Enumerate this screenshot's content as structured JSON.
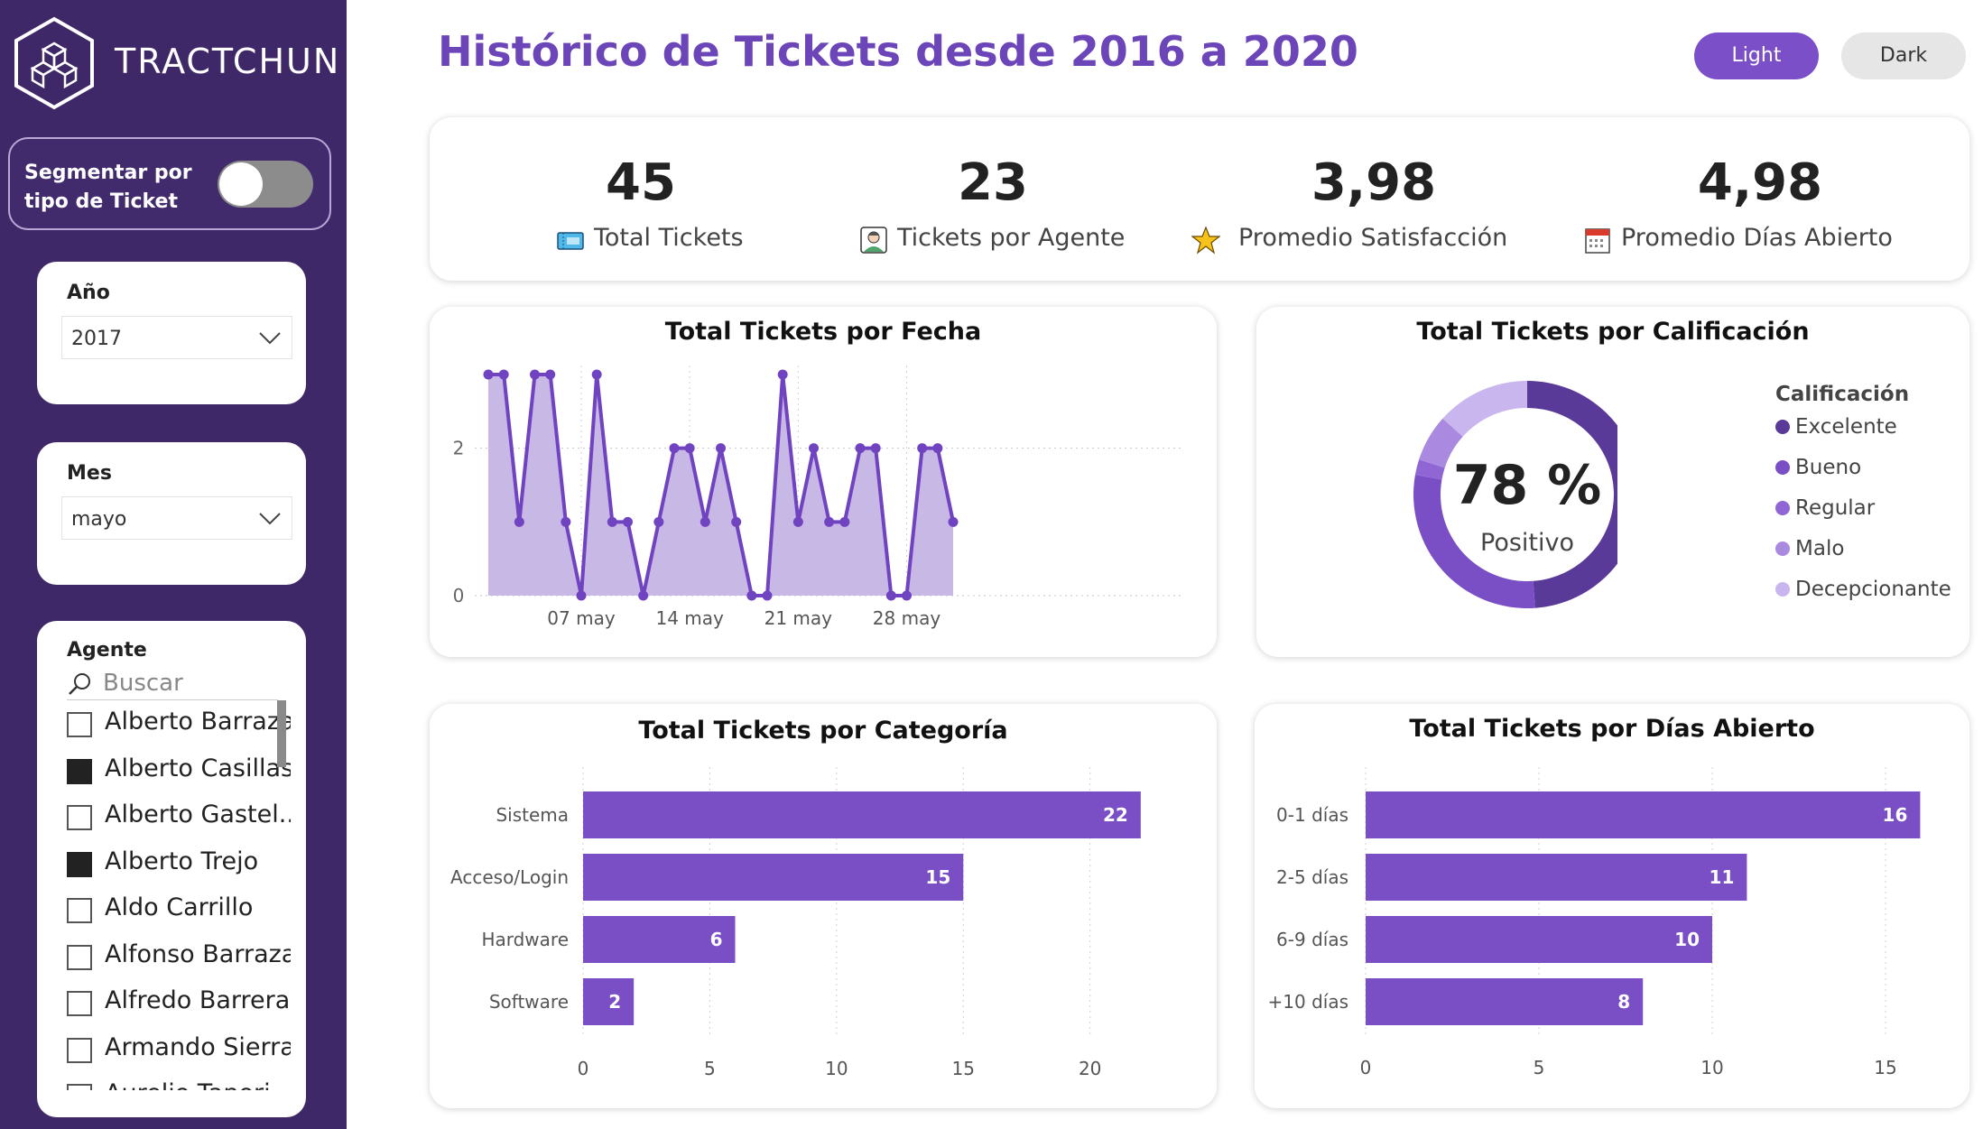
{
  "brand": {
    "name": "TRACTCHUN"
  },
  "sidebar": {
    "toggle_label": "Segmentar por tipo de Ticket",
    "anio": {
      "label": "Año",
      "value": "2017"
    },
    "mes": {
      "label": "Mes",
      "value": "mayo"
    },
    "agente": {
      "label": "Agente",
      "search_placeholder": "Buscar",
      "items": [
        {
          "name": "Alberto Barraza",
          "checked": false
        },
        {
          "name": "Alberto Casillas",
          "checked": true
        },
        {
          "name": "Alberto Gastel...",
          "checked": false
        },
        {
          "name": "Alberto Trejo",
          "checked": true
        },
        {
          "name": "Aldo Carrillo",
          "checked": false
        },
        {
          "name": "Alfonso Barraza",
          "checked": false
        },
        {
          "name": "Alfredo Barreras",
          "checked": false
        },
        {
          "name": "Armando Sierra",
          "checked": false
        },
        {
          "name": "Aurelio Tapori",
          "checked": false
        }
      ]
    }
  },
  "header": {
    "title": "Histórico de Tickets desde 2016 a 2020",
    "light_label": "Light",
    "dark_label": "Dark"
  },
  "kpis": [
    {
      "value": "45",
      "label": "Total Tickets",
      "icon": "ticket-icon"
    },
    {
      "value": "23",
      "label": "Tickets por Agente",
      "icon": "agent-icon"
    },
    {
      "value": "3,98",
      "label": "Promedio Satisfacción",
      "icon": "star-icon"
    },
    {
      "value": "4,98",
      "label": "Promedio Días Abierto",
      "icon": "calendar-icon"
    }
  ],
  "colors": {
    "accent": "#7b4fc7",
    "sidebar": "#3f2867",
    "bar": "#7a4fc6",
    "area": "#c8b8e6"
  },
  "chart_data": [
    {
      "type": "area",
      "title": "Total Tickets por Fecha",
      "x_ticks": [
        "07 may",
        "14 may",
        "21 may",
        "28 may"
      ],
      "y_ticks": [
        0,
        2
      ],
      "ylim": [
        0,
        3
      ],
      "x_dates": [
        "1 may",
        "2 may",
        "3 may",
        "4 may",
        "5 may",
        "6 may",
        "7 may",
        "8 may",
        "9 may",
        "10 may",
        "11 may",
        "12 may",
        "13 may",
        "14 may",
        "15 may",
        "16 may",
        "17 may",
        "18 may",
        "19 may",
        "20 may",
        "21 may",
        "22 may",
        "23 may",
        "24 may",
        "25 may",
        "26 may",
        "27 may",
        "28 may",
        "29 may",
        "30 may",
        "31 may"
      ],
      "values": [
        3,
        3,
        1,
        3,
        3,
        1,
        0,
        3,
        1,
        1,
        0,
        1,
        2,
        2,
        1,
        2,
        1,
        0,
        0,
        3,
        1,
        2,
        1,
        1,
        2,
        2,
        0,
        0,
        2,
        2,
        1
      ]
    },
    {
      "type": "pie",
      "title": "Total Tickets por Calificación",
      "center_value": "78 %",
      "center_label": "Positivo",
      "legend_title": "Calificación",
      "categories": [
        "Excelente",
        "Bueno",
        "Regular",
        "Malo",
        "Decepcionante"
      ],
      "values": [
        22,
        13,
        1,
        3,
        6
      ],
      "colors": [
        "#5a3a99",
        "#7a4fc6",
        "#8f66d4",
        "#a98ae0",
        "#c9b6ee"
      ]
    },
    {
      "type": "bar",
      "title": "Total Tickets por Categoría",
      "categories": [
        "Sistema",
        "Acceso/Login",
        "Hardware",
        "Software"
      ],
      "values": [
        22,
        15,
        6,
        2
      ],
      "x_ticks": [
        0,
        5,
        10,
        15,
        20
      ],
      "xlim": [
        0,
        24
      ]
    },
    {
      "type": "bar",
      "title": "Total Tickets por Días Abierto",
      "categories": [
        "0-1 días",
        "2-5 días",
        "6-9 días",
        "+10 días"
      ],
      "values": [
        16,
        11,
        10,
        8
      ],
      "x_ticks": [
        0,
        5,
        10,
        15
      ],
      "xlim": [
        0,
        17.5
      ]
    }
  ]
}
